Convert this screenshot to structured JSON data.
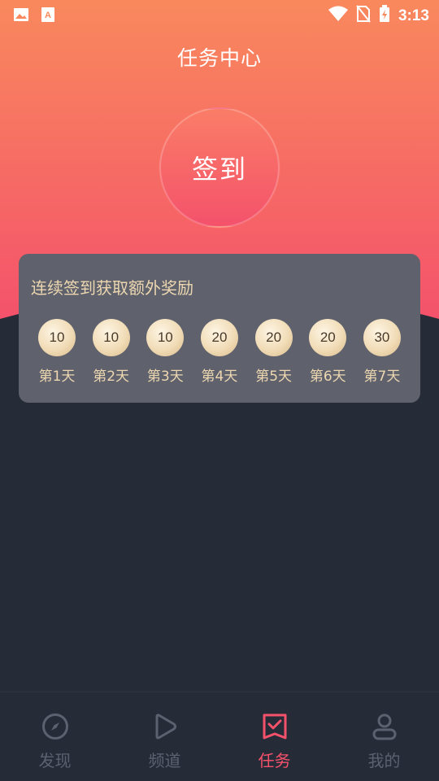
{
  "status_bar": {
    "time": "3:13",
    "left_icons": [
      "image-icon",
      "text-app-icon"
    ],
    "right_icons": [
      "wifi-icon",
      "no-sim-icon",
      "battery-charging-icon"
    ]
  },
  "header": {
    "title": "任务中心"
  },
  "checkin": {
    "label": "签到"
  },
  "reward_card": {
    "title": "连续签到获取额外奖励",
    "days": [
      {
        "points": "10",
        "label": "第1天"
      },
      {
        "points": "10",
        "label": "第2天"
      },
      {
        "points": "10",
        "label": "第3天"
      },
      {
        "points": "20",
        "label": "第4天"
      },
      {
        "points": "20",
        "label": "第5天"
      },
      {
        "points": "20",
        "label": "第6天"
      },
      {
        "points": "30",
        "label": "第7天"
      }
    ]
  },
  "tab_bar": {
    "tabs": [
      {
        "label": "发现",
        "icon": "compass-icon",
        "active": false
      },
      {
        "label": "频道",
        "icon": "play-icon",
        "active": false
      },
      {
        "label": "任务",
        "icon": "task-check-icon",
        "active": true
      },
      {
        "label": "我的",
        "icon": "user-icon",
        "active": false
      }
    ]
  },
  "colors": {
    "gradient_top": "#f9895d",
    "gradient_bottom": "#f4526b",
    "background": "#262b38",
    "card": "#5f616c",
    "accent_gold": "#ecd7b0",
    "active_tab": "#f4526b",
    "inactive_tab": "#5c6170"
  }
}
